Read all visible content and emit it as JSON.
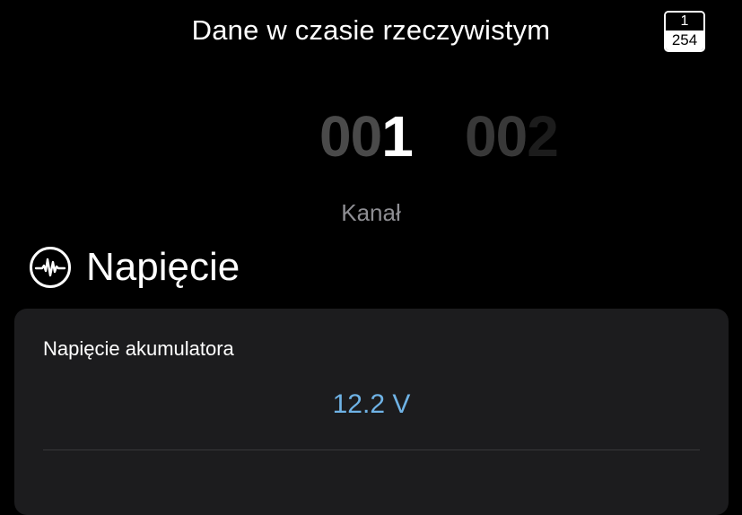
{
  "header": {
    "title": "Dane w czasie rzeczywistym",
    "page_badge": {
      "current": "1",
      "total": "254"
    }
  },
  "channel_picker": {
    "current": {
      "prefix": "00",
      "digit": "1"
    },
    "next": {
      "prefix": "00",
      "digit": "2"
    },
    "label": "Kanał"
  },
  "section": {
    "icon": "waveform-circle-icon",
    "title": "Napięcie"
  },
  "card": {
    "label": "Napięcie akumulatora",
    "value": "12.2 V"
  },
  "colors": {
    "background": "#000000",
    "card_background": "#1c1c1e",
    "value_accent": "#6fb3e6",
    "secondary_text": "#8e8e93"
  }
}
